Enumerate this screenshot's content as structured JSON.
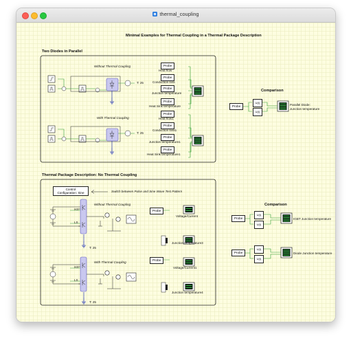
{
  "window": {
    "title": "thermal_coupling"
  },
  "canvas": {
    "title": "Minimal Examples for Thermal Coupling in a Thermal Package Description",
    "section1": {
      "heading": "Two Diodes in Parallel",
      "without_label": "Without Thermal Coupling",
      "with_label": "With Thermal Coupling",
      "temp1": "T: 25",
      "temp2": "T: 25",
      "probe": "Probe",
      "outputs_top": [
        "Heat flow",
        "Conduction loss",
        "Junction temperature",
        "Heat Sink temperature"
      ],
      "outputs_bottom": [
        "Heat flow1",
        "Conduction loss1",
        "Junction temperature1",
        "Heat Sink temperature1"
      ]
    },
    "comparison1": {
      "heading": "Comparison",
      "probe": "Probe",
      "u_label": "U(I)",
      "scope_label_line1": "Parallel Diode:",
      "scope_label_line2": "Junction temperature"
    },
    "section2": {
      "heading": "Thermal Package Description: No Thermal Coupling",
      "control_line1": "Control",
      "control_line2": "Configuration: Sine",
      "switch_note": "Switch between Pulse and Sine Wave Test Pattern",
      "without_label": "Without Thermal Coupling",
      "with_label": "With Thermal Coupling",
      "temp1": "T: 25",
      "temp2": "T: 25",
      "probe": "Probe",
      "gate_hs": "HS",
      "gate_ls": "LS",
      "outputs": [
        "Voltage/Current",
        "Junction temperature3",
        "Voltage/Current1",
        "Junction temperature4"
      ]
    },
    "comparison2": {
      "heading": "Comparison",
      "probe": "Probe",
      "u_label": "U(I)",
      "scope_igbt": "IGBT Junction temperature",
      "scope_diode": "Diode Junction temperature"
    }
  },
  "colors": {
    "wire": "#2f9e2f",
    "component": "#c9c8ef",
    "heat": "#2b3bb8",
    "canvas": "#fdfde0"
  }
}
